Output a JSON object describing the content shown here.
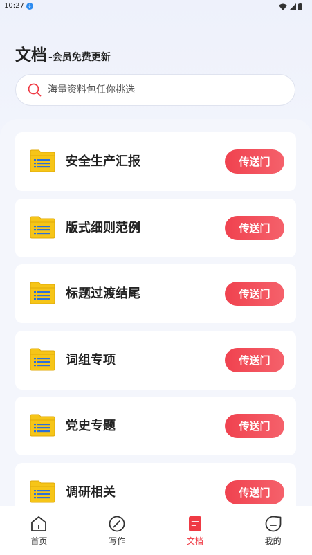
{
  "status_bar": {
    "time": "10:27"
  },
  "header": {
    "title": "文档",
    "subtitle": "-会员免费更新"
  },
  "search": {
    "placeholder": "海量资料包任你挑选"
  },
  "documents": [
    {
      "title": "安全生产汇报",
      "button": "传送门"
    },
    {
      "title": "版式细则范例",
      "button": "传送门"
    },
    {
      "title": "标题过渡结尾",
      "button": "传送门"
    },
    {
      "title": "词组专项",
      "button": "传送门"
    },
    {
      "title": "党史专题",
      "button": "传送门"
    },
    {
      "title": "调研相关",
      "button": "传送门"
    }
  ],
  "nav": [
    {
      "label": "首页",
      "icon": "home-icon",
      "active": false
    },
    {
      "label": "写作",
      "icon": "compass-icon",
      "active": false
    },
    {
      "label": "文档",
      "icon": "document-icon",
      "active": true
    },
    {
      "label": "我的",
      "icon": "profile-icon",
      "active": false
    }
  ],
  "colors": {
    "accent": "#ef3a44",
    "folder": "#f6c518",
    "folder_lines": "#2d6fd8"
  }
}
